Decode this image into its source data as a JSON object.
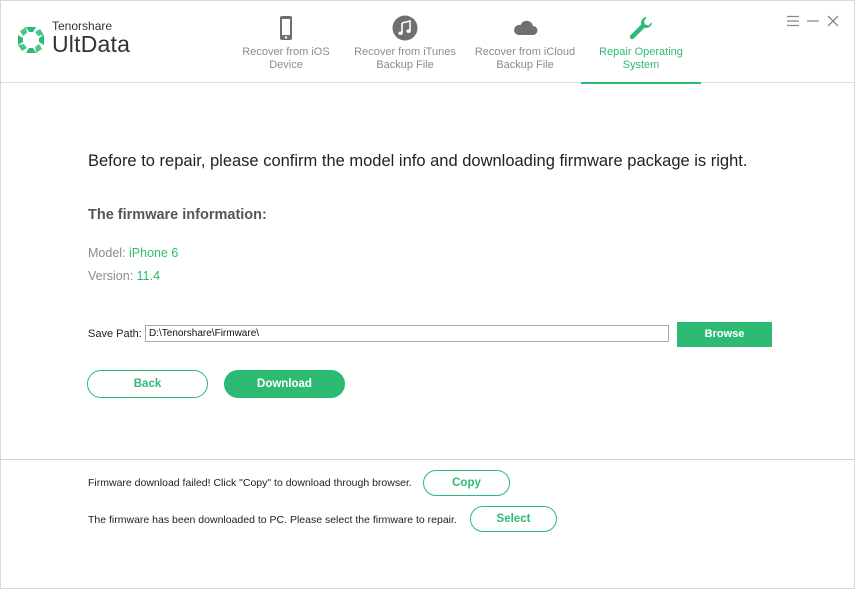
{
  "app": {
    "brand_small": "Tenorshare",
    "brand_big": "UltData",
    "accent_color": "#2dbb74"
  },
  "tabs": [
    {
      "label": "Recover from iOS\nDevice",
      "icon": "phone-icon",
      "active": false
    },
    {
      "label": "Recover from iTunes\nBackup File",
      "icon": "music-note-icon",
      "active": false
    },
    {
      "label": "Recover from iCloud\nBackup File",
      "icon": "cloud-icon",
      "active": false
    },
    {
      "label": "Repair Operating\nSystem",
      "icon": "wrench-icon",
      "active": true
    }
  ],
  "window_controls": [
    "menu-icon",
    "minimize-icon",
    "close-icon"
  ],
  "main": {
    "headline": "Before to repair, please confirm the model info and downloading firmware package is right.",
    "firmware_title": "The firmware information:",
    "model_label": "Model: ",
    "model_value": "iPhone 6",
    "version_label": "Version: ",
    "version_value": "11.4",
    "save_path_label": "Save Path:",
    "save_path_value": "D:\\Tenorshare\\Firmware\\",
    "browse_label": "Browse",
    "back_label": "Back",
    "download_label": "Download"
  },
  "footer": {
    "failed_text": "Firmware download failed! Click \"Copy\" to download through browser.",
    "copy_label": "Copy",
    "downloaded_text": "The firmware has been downloaded to PC. Please select the firmware to repair.",
    "select_label": "Select"
  }
}
